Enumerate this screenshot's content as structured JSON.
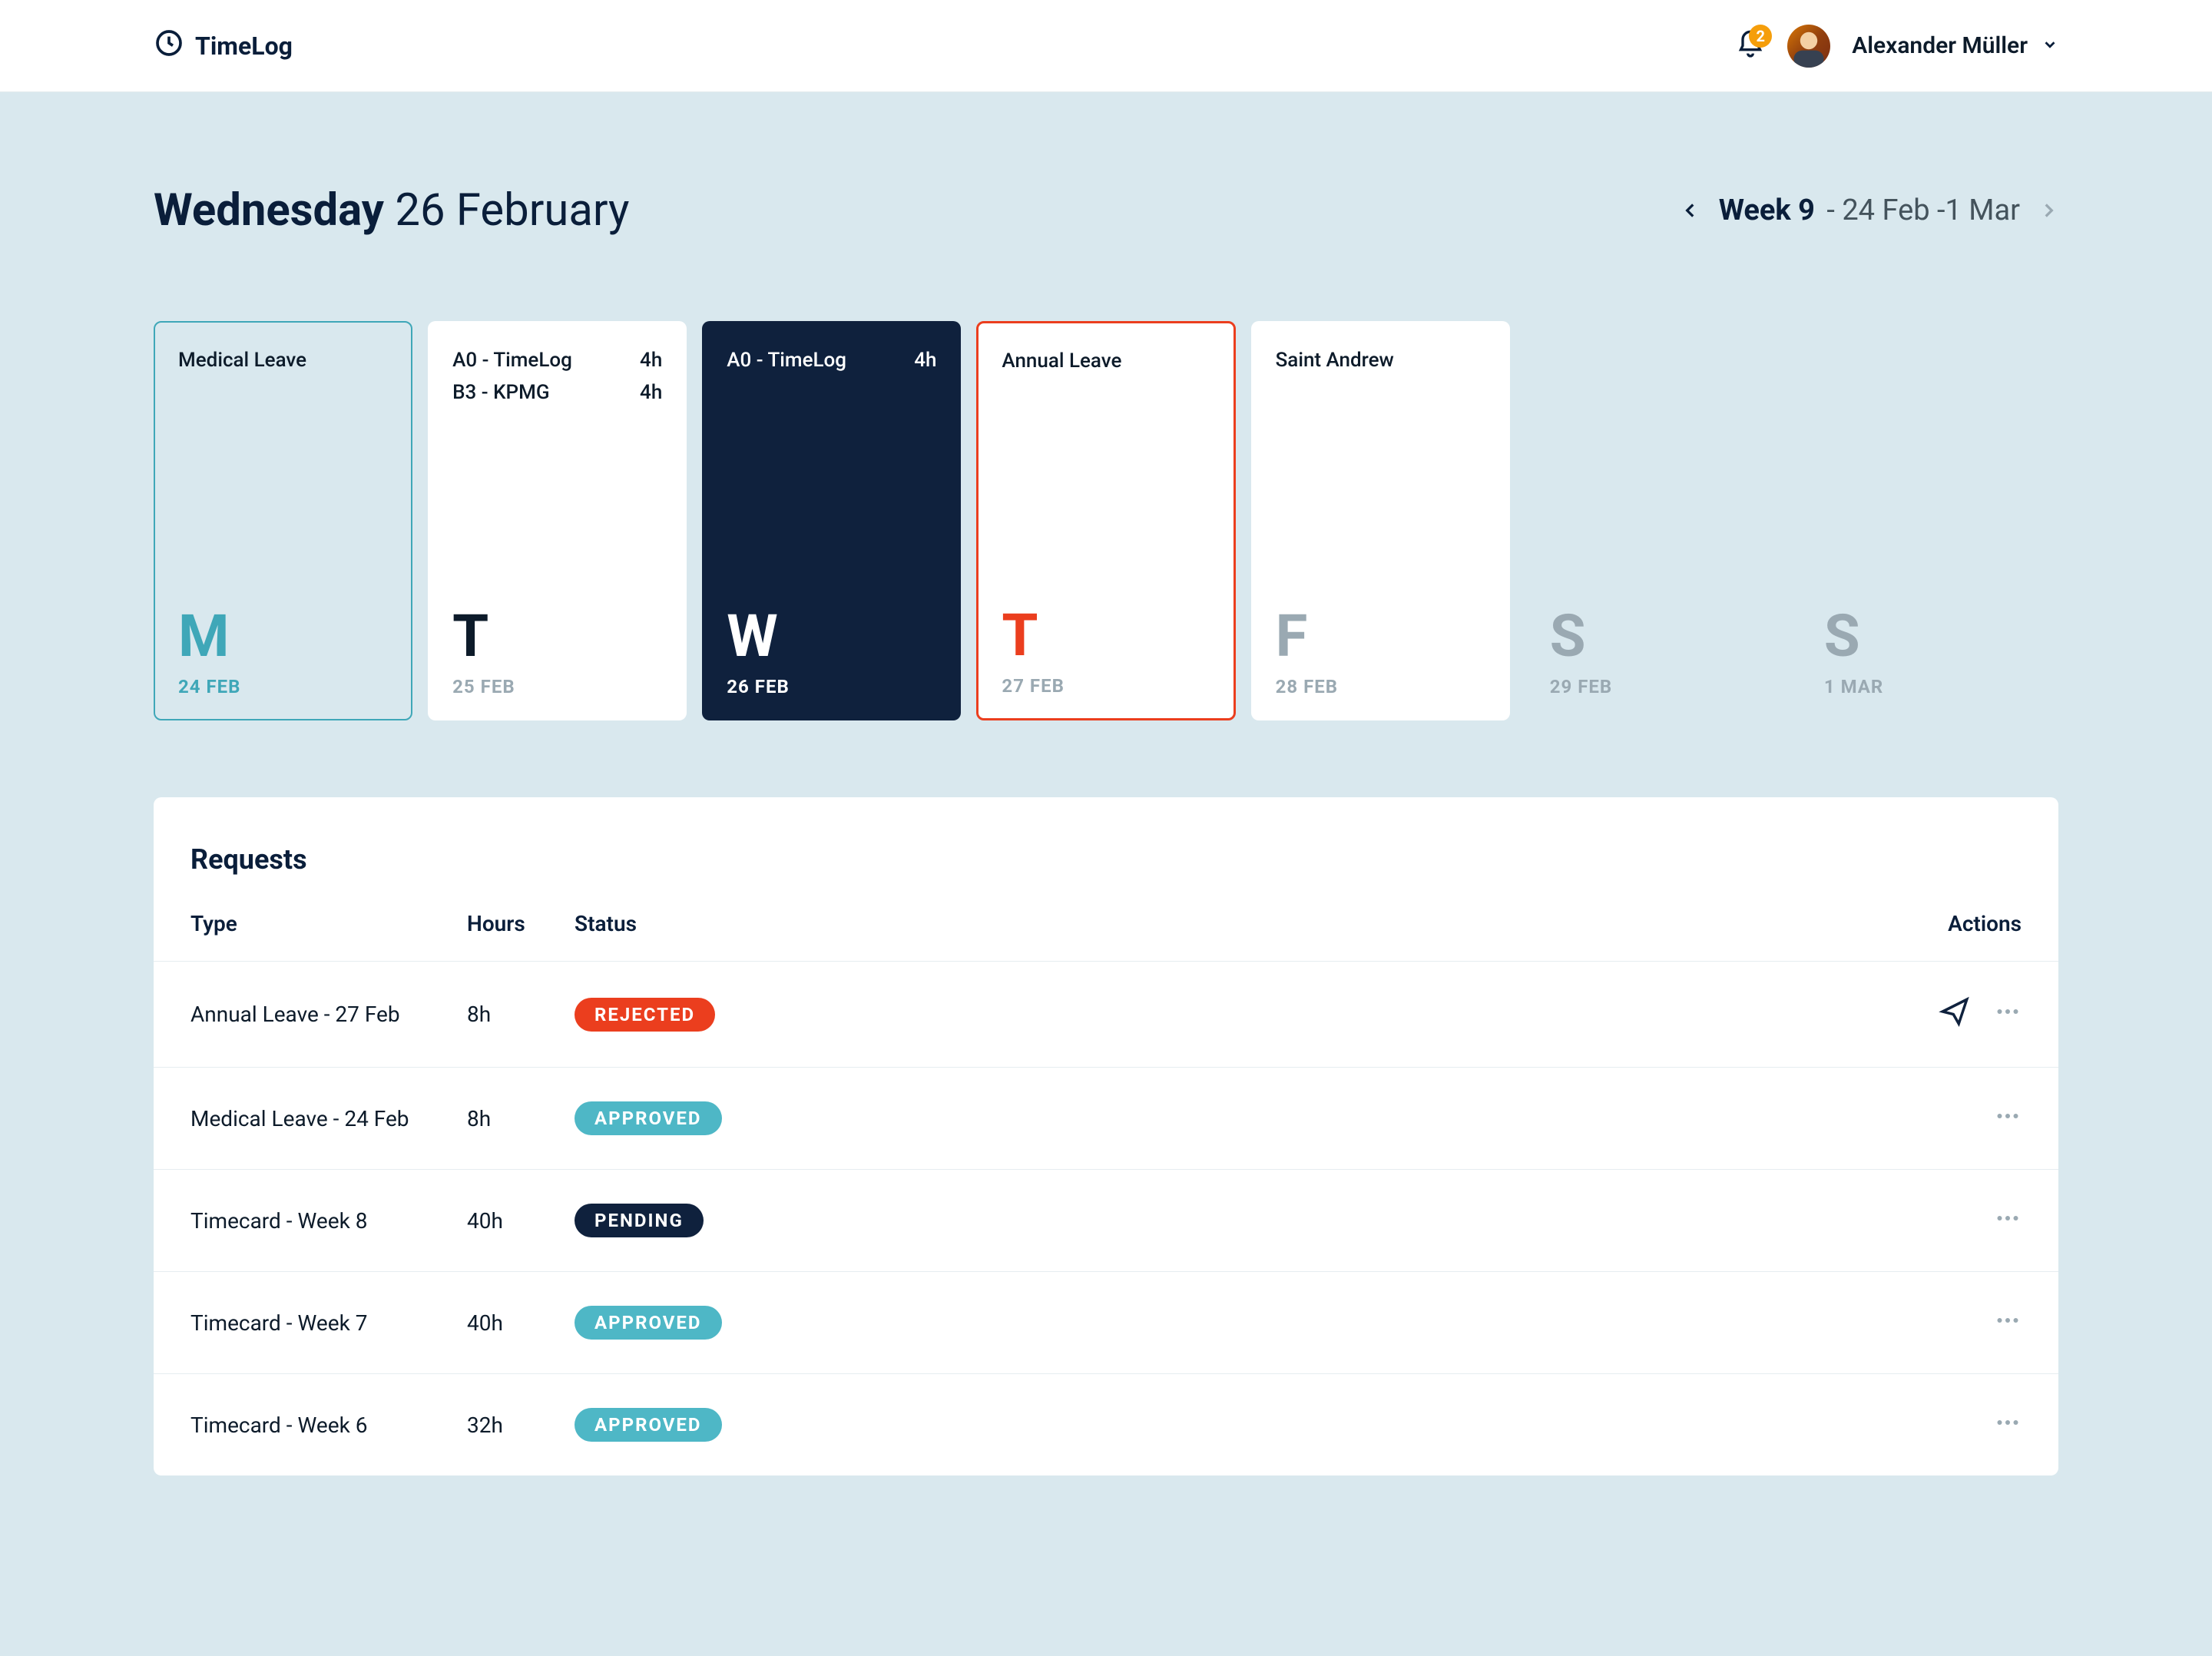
{
  "brand": {
    "name": "TimeLog"
  },
  "header": {
    "notification_count": "2",
    "user_name": "Alexander Müller"
  },
  "title": {
    "dayname": "Wednesday",
    "date": "26 February"
  },
  "week_picker": {
    "label": "Week 9",
    "range": "- 24 Feb -1 Mar"
  },
  "days": [
    {
      "letter": "M",
      "date": "24 FEB",
      "variant": "monday",
      "entries": [
        {
          "label": "Medical Leave",
          "hours": ""
        }
      ]
    },
    {
      "letter": "T",
      "date": "25 FEB",
      "variant": "tuesday",
      "entries": [
        {
          "label": "A0 - TimeLog",
          "hours": "4h"
        },
        {
          "label": "B3 - KPMG",
          "hours": "4h"
        }
      ]
    },
    {
      "letter": "W",
      "date": "26 FEB",
      "variant": "wednesday",
      "entries": [
        {
          "label": "A0 - TimeLog",
          "hours": "4h"
        }
      ]
    },
    {
      "letter": "T",
      "date": "27 FEB",
      "variant": "thursday",
      "entries": [
        {
          "label": "Annual Leave",
          "hours": ""
        }
      ]
    },
    {
      "letter": "F",
      "date": "28 FEB",
      "variant": "friday",
      "entries": [
        {
          "label": "Saint Andrew",
          "hours": ""
        }
      ]
    },
    {
      "letter": "S",
      "date": "29 FEB",
      "variant": "weekend",
      "entries": []
    },
    {
      "letter": "S",
      "date": "1 MAR",
      "variant": "weekend",
      "entries": []
    }
  ],
  "requests": {
    "title": "Requests",
    "columns": {
      "type": "Type",
      "hours": "Hours",
      "status": "Status",
      "actions": "Actions"
    },
    "rows": [
      {
        "type": "Annual Leave - 27 Feb",
        "hours": "8h",
        "status": "REJECTED",
        "status_kind": "rejected",
        "has_send": true
      },
      {
        "type": "Medical Leave - 24 Feb",
        "hours": "8h",
        "status": "APPROVED",
        "status_kind": "approved",
        "has_send": false
      },
      {
        "type": "Timecard - Week 8",
        "hours": "40h",
        "status": "PENDING",
        "status_kind": "pending",
        "has_send": false
      },
      {
        "type": "Timecard - Week 7",
        "hours": "40h",
        "status": "APPROVED",
        "status_kind": "approved",
        "has_send": false
      },
      {
        "type": "Timecard - Week 6",
        "hours": "32h",
        "status": "APPROVED",
        "status_kind": "approved",
        "has_send": false
      }
    ]
  }
}
